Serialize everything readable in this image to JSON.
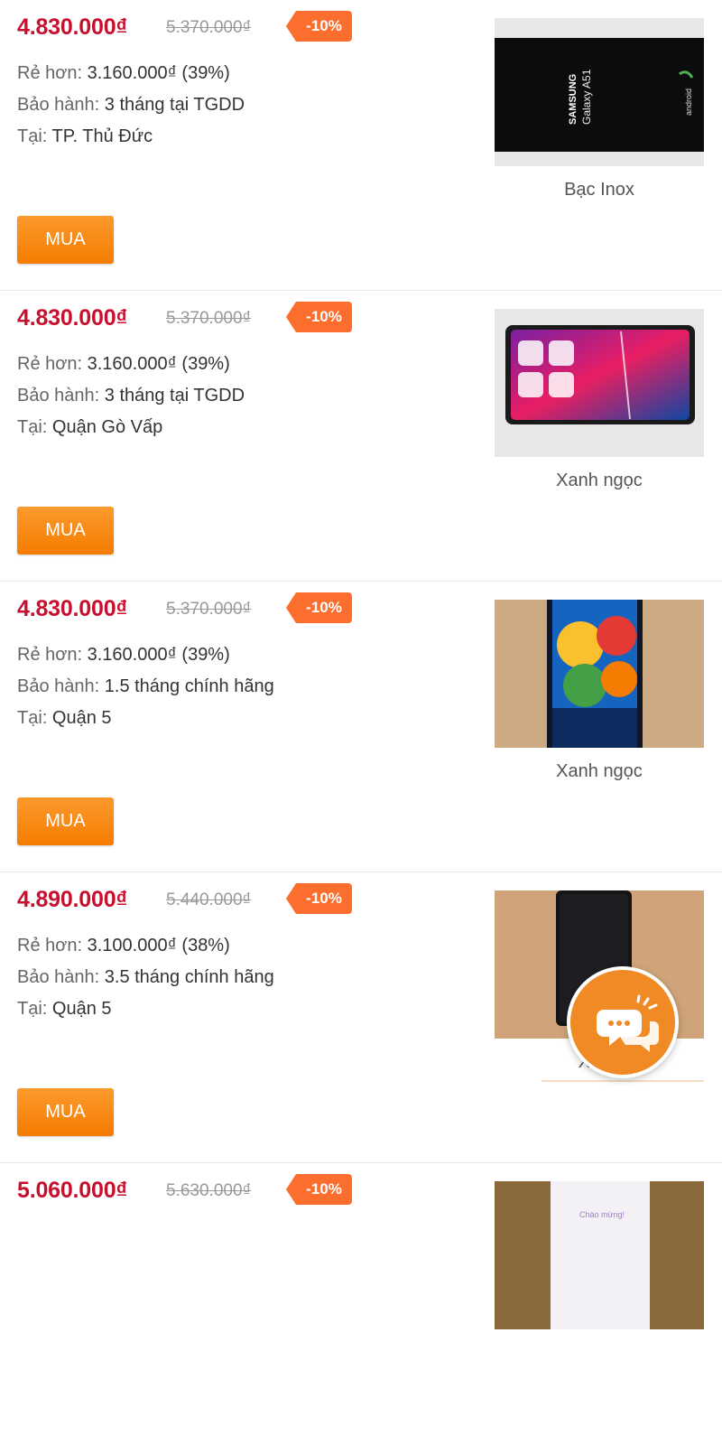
{
  "listings": [
    {
      "price": "4.830.000₫",
      "old_price": "5.370.000₫",
      "discount": "-10%",
      "cheaper_label": "Rẻ hơn:",
      "cheaper_value": "3.160.000₫ (39%)",
      "warranty_label": "Bảo hành:",
      "warranty_value": "3 tháng tại TGDD",
      "location_label": "Tại:",
      "location_value": "TP. Thủ Đức",
      "buy_label": "MUA",
      "color": "Bạc Inox",
      "image_text_1": "SAMSUNG",
      "image_text_2": "Galaxy A51",
      "image_text_3": "android"
    },
    {
      "price": "4.830.000₫",
      "old_price": "5.370.000₫",
      "discount": "-10%",
      "cheaper_label": "Rẻ hơn:",
      "cheaper_value": "3.160.000₫ (39%)",
      "warranty_label": "Bảo hành:",
      "warranty_value": "3 tháng tại TGDD",
      "location_label": "Tại:",
      "location_value": "Quận Gò Vấp",
      "buy_label": "MUA",
      "color": "Xanh ngọc"
    },
    {
      "price": "4.830.000₫",
      "old_price": "5.370.000₫",
      "discount": "-10%",
      "cheaper_label": "Rẻ hơn:",
      "cheaper_value": "3.160.000₫ (39%)",
      "warranty_label": "Bảo hành:",
      "warranty_value": "1.5 tháng chính hãng",
      "location_label": "Tại:",
      "location_value": "Quận 5",
      "buy_label": "MUA",
      "color": "Xanh ngọc"
    },
    {
      "price": "4.890.000₫",
      "old_price": "5.440.000₫",
      "discount": "-10%",
      "cheaper_label": "Rẻ hơn:",
      "cheaper_value": "3.100.000₫ (38%)",
      "warranty_label": "Bảo hành:",
      "warranty_value": "3.5 tháng chính hãng",
      "location_label": "Tại:",
      "location_value": "Quận 5",
      "buy_label": "MUA",
      "color": "Xanh"
    },
    {
      "price": "5.060.000₫",
      "old_price": "5.630.000₫",
      "discount": "-10%",
      "image_text_1": "Chào mừng!"
    }
  ],
  "colors": {
    "price": "#c8102e",
    "badge": "#fb6e2e",
    "button": "#f57c00",
    "fab": "#f08a24"
  },
  "chat_fab": {
    "icon": "chat-bubbles-icon"
  }
}
